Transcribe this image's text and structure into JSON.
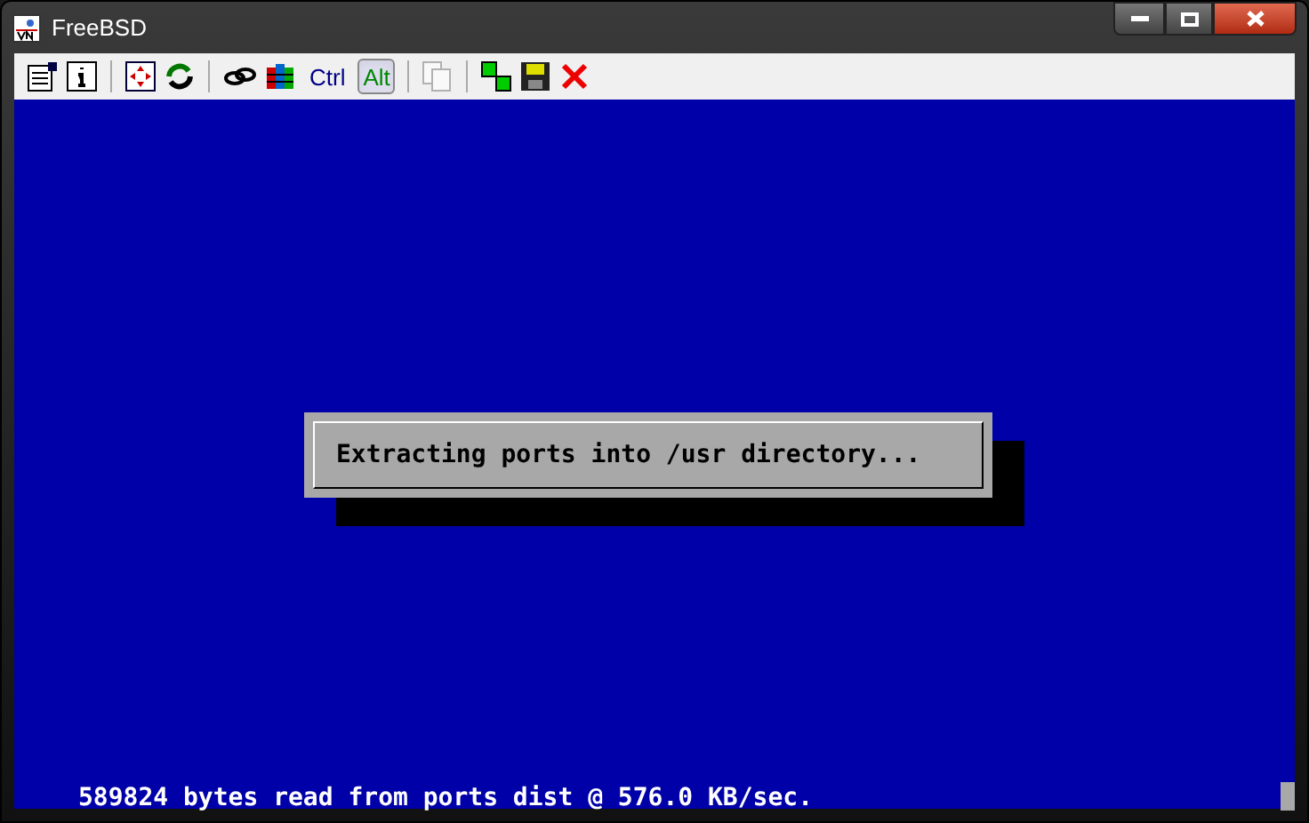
{
  "window": {
    "title": "FreeBSD"
  },
  "toolbar": {
    "ctrl": {
      "label": "Ctrl",
      "pressed": false
    },
    "alt": {
      "label": "Alt",
      "pressed": true
    },
    "copy_disabled": true
  },
  "console": {
    "dialog": {
      "message": "Extracting ports into /usr directory..."
    },
    "status_line": "589824 bytes read from ports dist @ 576.0 KB/sec."
  }
}
